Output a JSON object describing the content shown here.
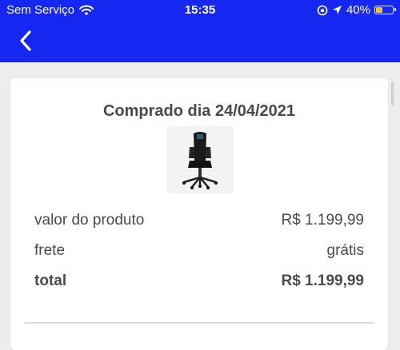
{
  "status_bar": {
    "carrier": "Sem Serviço",
    "time": "15:35",
    "battery_percent": "40%",
    "battery_level": 0.4,
    "battery_color": "#f2c23b"
  },
  "header": {
    "background": "#1727f2",
    "back_icon": "chevron-left-icon"
  },
  "order": {
    "title": "Comprado dia 24/04/2021",
    "product_image": "gaming-chair",
    "rows": [
      {
        "label": "valor do produto",
        "value": "R$ 1.199,99"
      },
      {
        "label": "frete",
        "value": "grátis"
      },
      {
        "label": "total",
        "value": "R$ 1.199,99"
      }
    ]
  }
}
